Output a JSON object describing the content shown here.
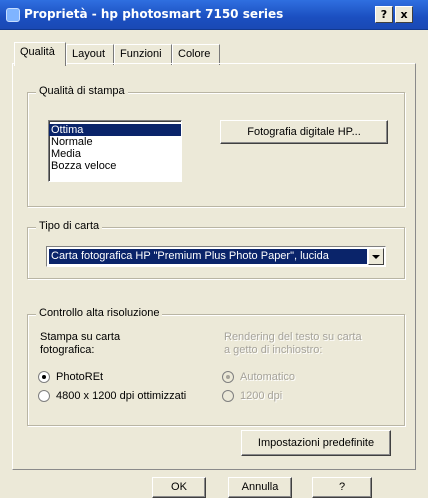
{
  "window": {
    "title": "Proprietà - hp photosmart 7150 series",
    "help_label": "?",
    "close_label": "x"
  },
  "tabs": [
    {
      "label": "Qualità",
      "active": true
    },
    {
      "label": "Layout",
      "active": false
    },
    {
      "label": "Funzioni",
      "active": false
    },
    {
      "label": "Colore",
      "active": false
    }
  ],
  "print_quality": {
    "legend": "Qualità di stampa",
    "options": [
      "Ottima",
      "Normale",
      "Media",
      "Bozza veloce"
    ],
    "selected": "Ottima",
    "photo_button": "Fotografia digitale HP..."
  },
  "paper": {
    "legend": "Tipo di carta",
    "selected": "Carta fotografica HP \"Premium Plus Photo Paper\", lucida"
  },
  "resolution": {
    "legend": "Controllo alta risoluzione",
    "photo_label_line1": "Stampa su carta",
    "photo_label_line2": "fotografica:",
    "photo_options": [
      {
        "label": "PhotoREt",
        "checked": true
      },
      {
        "label": "4800 x 1200 dpi ottimizzati",
        "checked": false
      }
    ],
    "inkjet_label_line1": "Rendering del testo su carta",
    "inkjet_label_line2": "a getto di inchiostro:",
    "inkjet_options": [
      {
        "label": "Automatico",
        "checked": true
      },
      {
        "label": "1200 dpi",
        "checked": false
      }
    ]
  },
  "defaults_button": "Impostazioni predefinite",
  "footer": {
    "ok": "OK",
    "cancel": "Annulla",
    "help": "?"
  }
}
